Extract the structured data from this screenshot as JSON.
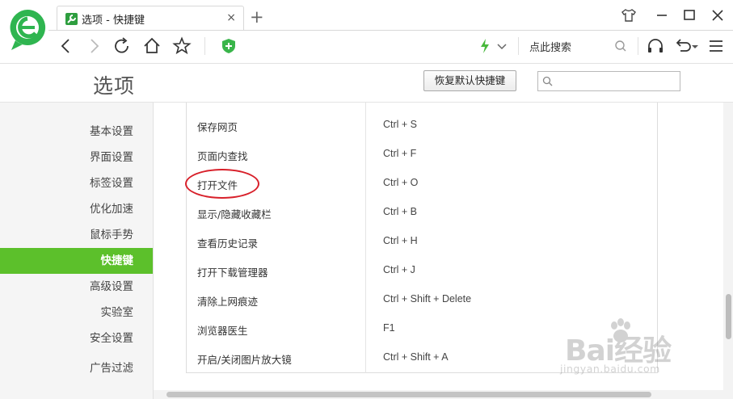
{
  "browser": {
    "tab_title": "选项 - 快捷键",
    "tab_close": "×",
    "new_tab": "+",
    "search_placeholder": "点此搜索"
  },
  "header": {
    "page_title": "选项",
    "restore_button": "恢复默认快捷键",
    "search_value": ""
  },
  "sidebar": {
    "items": [
      {
        "label": "基本设置",
        "active": false
      },
      {
        "label": "界面设置",
        "active": false
      },
      {
        "label": "标签设置",
        "active": false
      },
      {
        "label": "优化加速",
        "active": false
      },
      {
        "label": "鼠标手势",
        "active": false
      },
      {
        "label": "快捷键",
        "active": true
      },
      {
        "label": "高级设置",
        "active": false
      },
      {
        "label": "实验室",
        "active": false
      },
      {
        "label": "安全设置",
        "active": false
      },
      {
        "label": "广告过滤",
        "active": false
      }
    ]
  },
  "shortcuts": {
    "rows": [
      {
        "name": "保存网页",
        "key": "Ctrl + S"
      },
      {
        "name": "页面内查找",
        "key": "Ctrl + F"
      },
      {
        "name": "打开文件",
        "key": "Ctrl + O"
      },
      {
        "name": "显示/隐藏收藏栏",
        "key": "Ctrl + B"
      },
      {
        "name": "查看历史记录",
        "key": "Ctrl + H"
      },
      {
        "name": "打开下载管理器",
        "key": "Ctrl + J"
      },
      {
        "name": "清除上网痕迹",
        "key": "Ctrl + Shift + Delete"
      },
      {
        "name": "浏览器医生",
        "key": "F1"
      },
      {
        "name": "开启/关闭图片放大镜",
        "key": "Ctrl + Shift + A"
      }
    ]
  },
  "watermark": {
    "main": "Bai经验",
    "sub": "jingyan.baidu.com"
  },
  "colors": {
    "accent": "#5cc02b",
    "annotation": "#d8202a"
  }
}
